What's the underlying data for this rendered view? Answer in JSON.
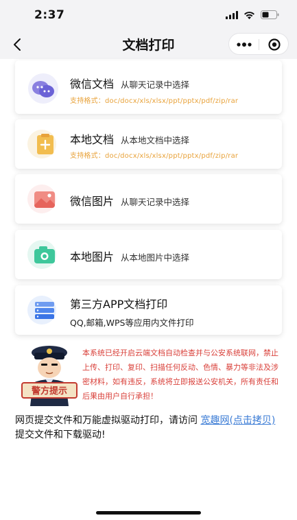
{
  "status": {
    "time": "2:37"
  },
  "nav": {
    "title": "文档打印"
  },
  "options": [
    {
      "title": "微信文档",
      "subtitle": "从聊天记录中选择",
      "formats": "支持格式：doc/docx/xls/xlsx/ppt/pptx/pdf/zip/rar",
      "icon": "wechat-chat-icon"
    },
    {
      "title": "本地文档",
      "subtitle": "从本地文档中选择",
      "formats": "支持格式：doc/docx/xls/xlsx/ppt/pptx/pdf/zip/rar",
      "icon": "local-file-icon"
    },
    {
      "title": "微信图片",
      "subtitle": "从聊天记录中选择",
      "icon": "image-icon"
    },
    {
      "title": "本地图片",
      "subtitle": "从本地图片中选择",
      "icon": "camera-icon"
    },
    {
      "title": "第三方APP文档打印",
      "desc": "QQ,邮箱,WPS等应用内文件打印",
      "icon": "server-icon"
    }
  ],
  "warning": {
    "badge": "警方提示",
    "text": "本系统已经开启云端文档自动检查并与公安系统联网，禁止上传、打印、复印、扫描任何反动、色情、暴力等非法及涉密材料，如有违反，系统将立即报送公安机关，所有责任和后果由用户自行承担！"
  },
  "footer": {
    "text_before": "网页提交文件和万能虚拟驱动打印，请访问 ",
    "link_text": "宽趣网(点击拷贝)",
    "text_after": " 提交文件和下载驱动!"
  },
  "colors": {
    "accent_orange": "#e8a23a",
    "warning_red": "#d9403a",
    "link_blue": "#3a7bd5"
  }
}
